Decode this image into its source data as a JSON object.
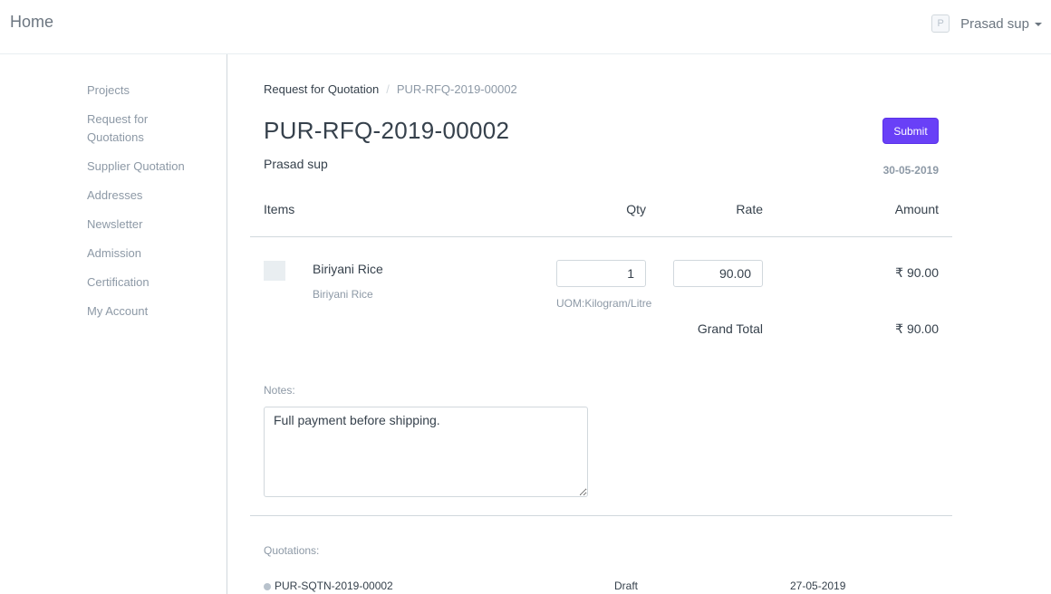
{
  "navbar": {
    "brand": "Home",
    "user": {
      "avatar_initial": "P",
      "name": "Prasad sup"
    }
  },
  "sidebar": {
    "items": [
      {
        "label": "Projects"
      },
      {
        "label": "Request for Quotations"
      },
      {
        "label": "Supplier Quotation"
      },
      {
        "label": "Addresses"
      },
      {
        "label": "Newsletter"
      },
      {
        "label": "Admission"
      },
      {
        "label": "Certification"
      },
      {
        "label": "My Account"
      }
    ]
  },
  "breadcrumb": {
    "parent": "Request for Quotation",
    "separator": "/",
    "current": "PUR-RFQ-2019-00002"
  },
  "document": {
    "title": "PUR-RFQ-2019-00002",
    "supplier": "Prasad sup",
    "date": "30-05-2019",
    "submit_label": "Submit",
    "accent_color": "#6940f7"
  },
  "items_table": {
    "headers": {
      "items": "Items",
      "qty": "Qty",
      "rate": "Rate",
      "amount": "Amount"
    },
    "rows": [
      {
        "name": "Biriyani Rice",
        "description": "Biriyani Rice",
        "qty": "1",
        "rate": "90.00",
        "uom": "UOM:Kilogram/Litre",
        "amount": "₹ 90.00"
      }
    ],
    "grand_total_label": "Grand Total",
    "grand_total": "₹ 90.00"
  },
  "notes": {
    "label": "Notes:",
    "value": "Full payment before shipping."
  },
  "quotations": {
    "label": "Quotations:",
    "rows": [
      {
        "name": "PUR-SQTN-2019-00002",
        "status": "Draft",
        "date": "27-05-2019"
      }
    ]
  }
}
